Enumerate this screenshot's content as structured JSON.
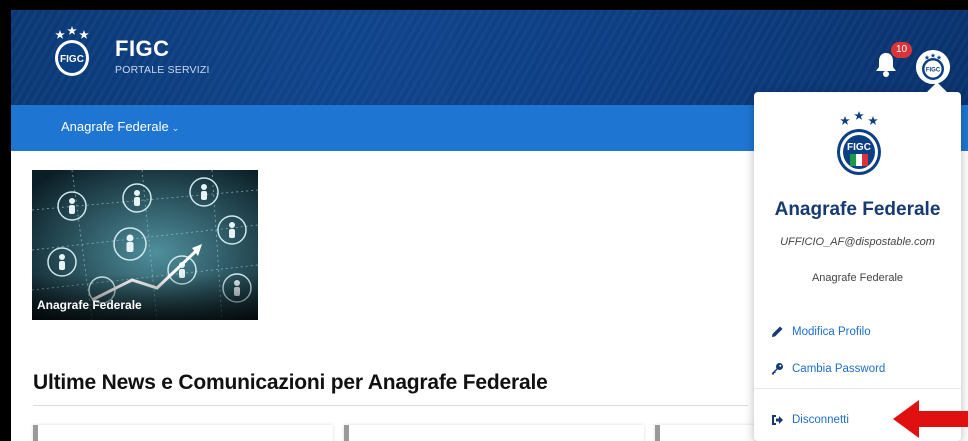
{
  "header": {
    "brand_title": "FIGC",
    "brand_subtitle": "PORTALE SERVIZI",
    "notification_count": "10",
    "colors": {
      "header_bg": "#0d3f85",
      "nav_bg": "#1f76d2",
      "badge": "#d9343a"
    }
  },
  "nav": {
    "items": [
      {
        "label": "Anagrafe Federale",
        "icon": "chevron-down-icon"
      }
    ]
  },
  "tiles": [
    {
      "label": "Anagrafe Federale"
    }
  ],
  "news": {
    "title": "Ultime News e Comunicazioni per Anagrafe Federale"
  },
  "user_menu": {
    "name": "Anagrafe Federale",
    "email": "UFFICIO_AF@dispostable.com",
    "role": "Anagrafe Federale",
    "items": [
      {
        "label": "Modifica Profilo",
        "icon": "pencil-icon"
      },
      {
        "label": "Cambia Password",
        "icon": "key-icon"
      },
      {
        "label": "Disconnetti",
        "icon": "sign-out-icon"
      }
    ],
    "accent": "#1e6fc9"
  },
  "annotation": {
    "arrow_color": "#e01010"
  }
}
